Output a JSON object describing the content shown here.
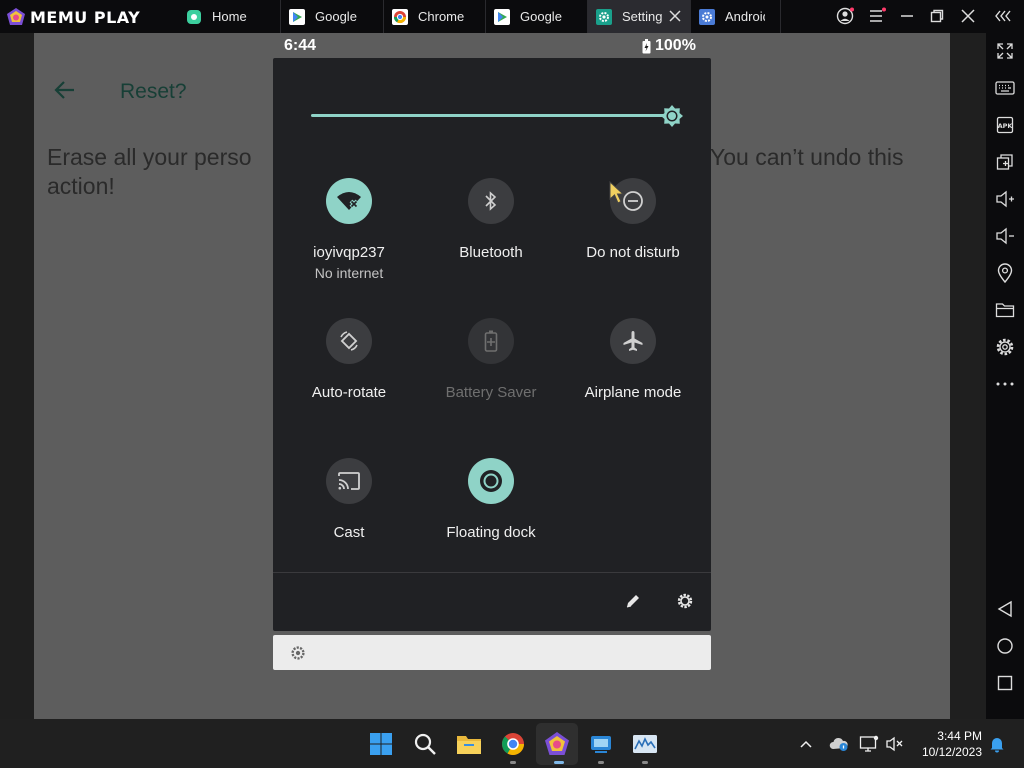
{
  "app": {
    "brand": "MEMU PLAY"
  },
  "tabs": [
    {
      "label": "Home",
      "icon": "home-app-icon"
    },
    {
      "label": "Google",
      "icon": "play-store-icon"
    },
    {
      "label": "Chrome",
      "icon": "chrome-icon"
    },
    {
      "label": "Google",
      "icon": "play-store-icon"
    },
    {
      "label": "Settings",
      "icon": "settings-gear-icon",
      "active": true
    },
    {
      "label": "Android",
      "icon": "android-settings-icon"
    }
  ],
  "status_bar": {
    "time": "6:44",
    "battery": "100%"
  },
  "background_app": {
    "title": "Reset?",
    "body_left": "Erase all your perso",
    "body_right": "You can’t undo this",
    "body_line2": "action!"
  },
  "quick_settings": {
    "brightness_percent": 100,
    "tiles": [
      {
        "id": "wifi",
        "label": "ioyivqp237",
        "sub": "No internet",
        "state": "on"
      },
      {
        "id": "bluetooth",
        "label": "Bluetooth",
        "state": "off"
      },
      {
        "id": "dnd",
        "label": "Do not disturb",
        "state": "off"
      },
      {
        "id": "autorotate",
        "label": "Auto-rotate",
        "state": "off"
      },
      {
        "id": "battery-saver",
        "label": "Battery Saver",
        "state": "disabled"
      },
      {
        "id": "airplane",
        "label": "Airplane mode",
        "state": "off"
      },
      {
        "id": "cast",
        "label": "Cast",
        "state": "off"
      },
      {
        "id": "floating-dock",
        "label": "Floating dock",
        "state": "on"
      }
    ]
  },
  "taskbar": {
    "time": "3:44 PM",
    "date": "10/12/2023"
  },
  "colors": {
    "accent": "#8fd3c7",
    "panel": "#202124",
    "dim_app": "#5d5d5d"
  }
}
